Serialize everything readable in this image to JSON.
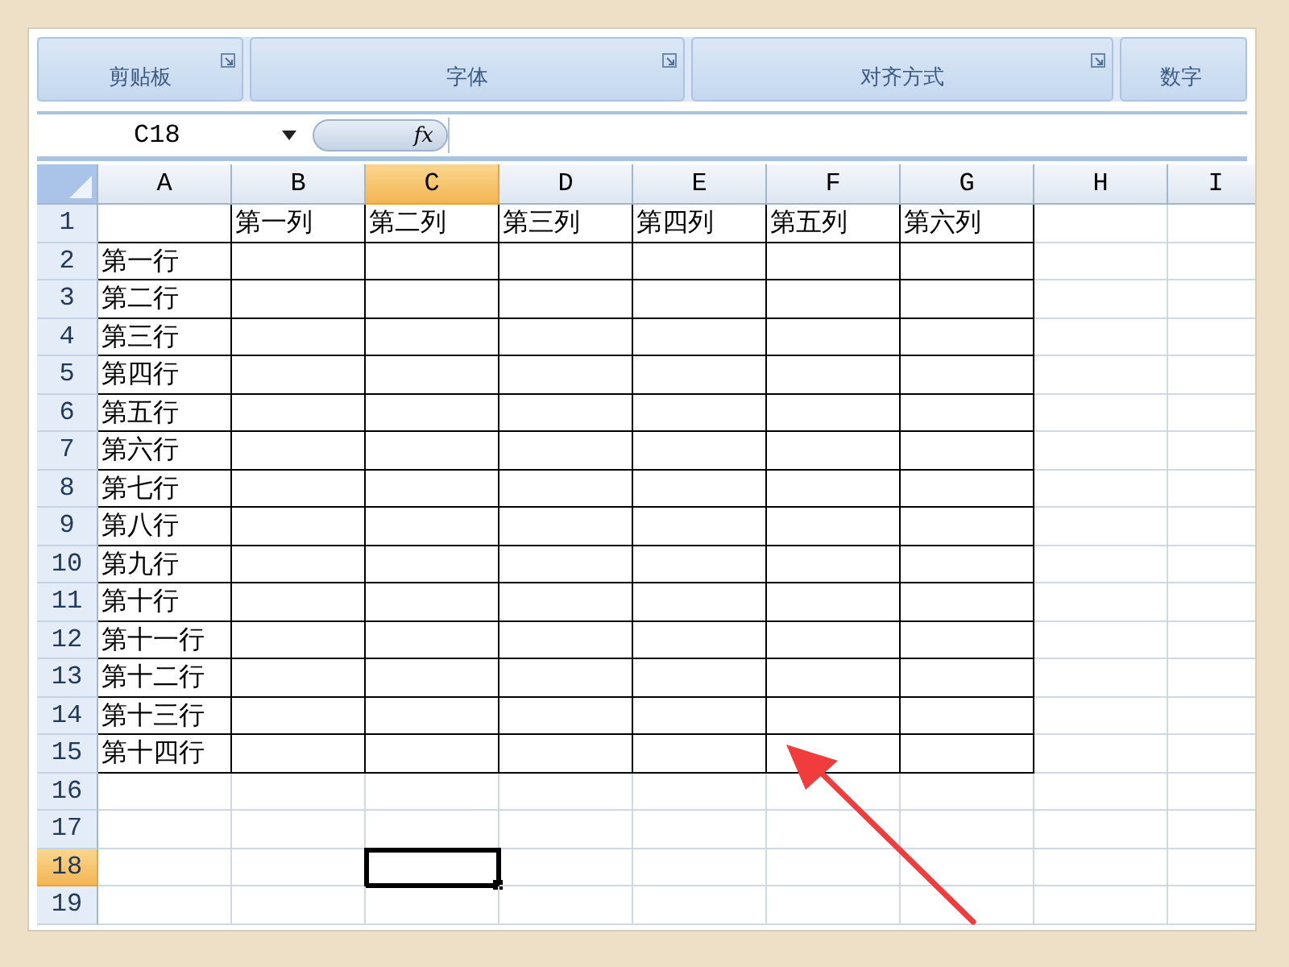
{
  "ribbon_groups": [
    {
      "label": "剪贴板",
      "launcher": true
    },
    {
      "label": "字体",
      "launcher": true
    },
    {
      "label": "对齐方式",
      "launcher": true
    },
    {
      "label": "数字",
      "launcher": false
    }
  ],
  "formula_bar": {
    "name_box": "C18",
    "fx": "fx"
  },
  "columns": [
    {
      "label": "A",
      "selected": false
    },
    {
      "label": "B",
      "selected": false
    },
    {
      "label": "C",
      "selected": true
    },
    {
      "label": "D",
      "selected": false
    },
    {
      "label": "E",
      "selected": false
    },
    {
      "label": "F",
      "selected": false
    },
    {
      "label": "G",
      "selected": false
    },
    {
      "label": "H",
      "selected": false
    },
    {
      "label": "I",
      "selected": false
    }
  ],
  "header_row": {
    "number": "1",
    "cells": [
      "第一列",
      "第二列",
      "第三列",
      "第四列",
      "第五列",
      "第六列"
    ]
  },
  "rows": [
    {
      "number": "2",
      "label": "第一行"
    },
    {
      "number": "3",
      "label": "第二行"
    },
    {
      "number": "4",
      "label": "第三行"
    },
    {
      "number": "5",
      "label": "第四行"
    },
    {
      "number": "6",
      "label": "第五行"
    },
    {
      "number": "7",
      "label": "第六行"
    },
    {
      "number": "8",
      "label": "第七行"
    },
    {
      "number": "9",
      "label": "第八行"
    },
    {
      "number": "10",
      "label": "第九行"
    },
    {
      "number": "11",
      "label": "第十行"
    },
    {
      "number": "12",
      "label": "第十一行"
    },
    {
      "number": "13",
      "label": "第十二行"
    },
    {
      "number": "14",
      "label": "第十三行"
    },
    {
      "number": "15",
      "label": "第十四行"
    }
  ],
  "blank_rows": [
    {
      "number": "16",
      "selected": false
    },
    {
      "number": "17",
      "selected": false
    },
    {
      "number": "18",
      "selected": true
    },
    {
      "number": "19",
      "selected": false
    }
  ],
  "annotation": {
    "kind": "arrow"
  }
}
